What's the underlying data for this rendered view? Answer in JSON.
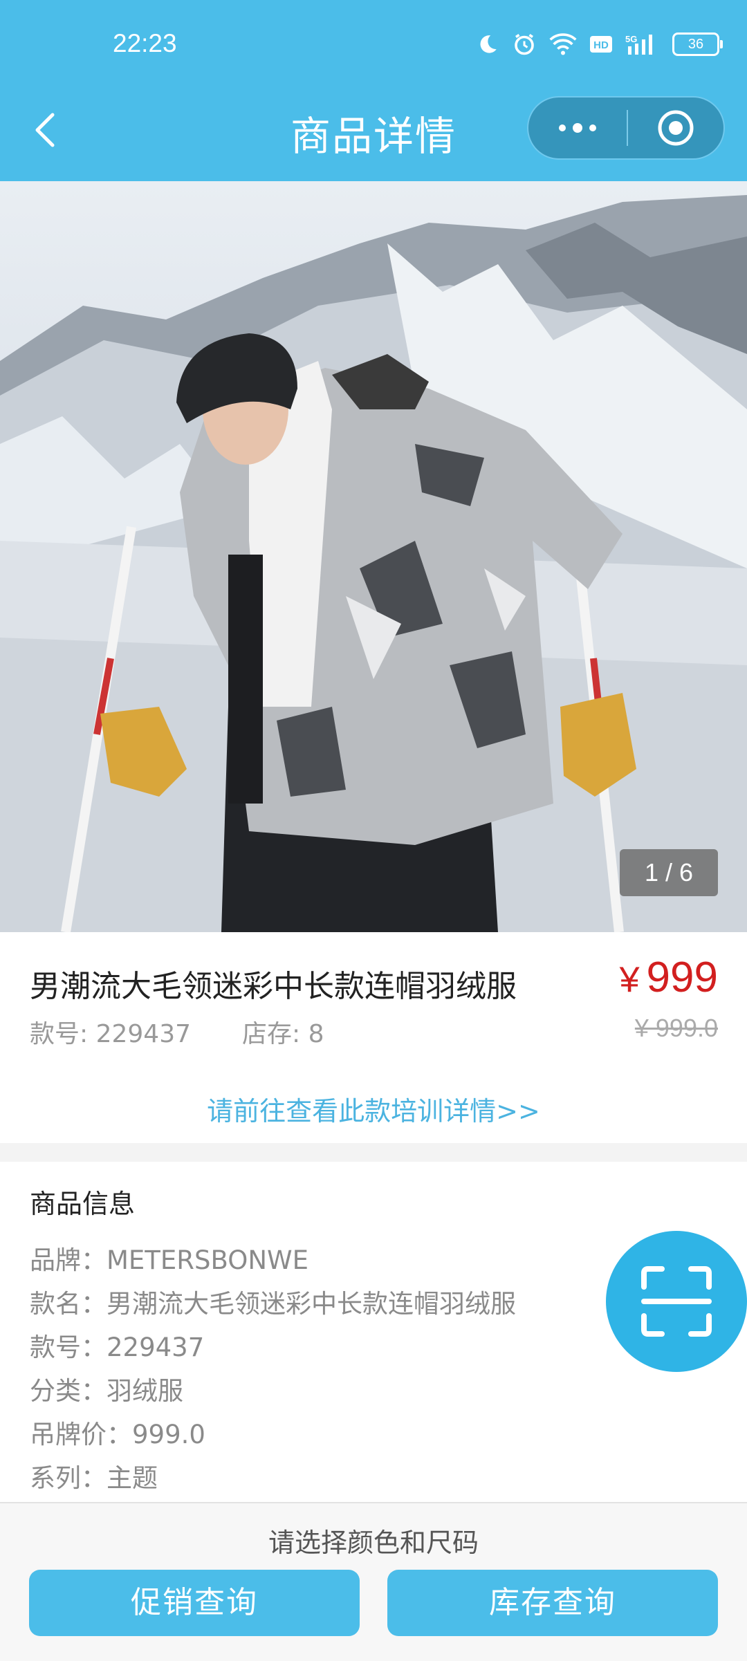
{
  "status_bar": {
    "time": "22:23",
    "battery": "36",
    "icons": [
      "moon-icon",
      "alarm-icon",
      "wifi-icon",
      "hd-icon",
      "5g-signal-icon",
      "battery-icon"
    ]
  },
  "header": {
    "title": "商品详情",
    "back_icon": "chevron-left-icon",
    "more_icon": "more-dots-icon",
    "record_icon": "record-icon"
  },
  "gallery": {
    "counter": "1 / 6",
    "current": 1,
    "total": 6
  },
  "product": {
    "name": "男潮流大毛领迷彩中长款连帽羽绒服",
    "currency": "¥",
    "price": "999",
    "style_no_text": "款号: 229437",
    "stock_text": "店存: 8",
    "original_price": "¥ 999.0",
    "training_link": "请前往查看此款培训详情>>"
  },
  "info": {
    "title": "商品信息",
    "attributes": [
      {
        "text": "品牌：METERSBONWE"
      },
      {
        "text": "款名：男潮流大毛领迷彩中长款连帽羽绒服"
      },
      {
        "text": "款号：229437"
      },
      {
        "text": "分类：羽绒服"
      },
      {
        "text": "吊牌价：999.0"
      },
      {
        "text": "系列：主题"
      }
    ]
  },
  "scan_button": {
    "icon": "scan-icon"
  },
  "footer": {
    "hint": "请选择颜色和尺码",
    "promo_button": "促销查询",
    "stock_button": "库存查询"
  },
  "colors": {
    "accent": "#4bbde9",
    "price": "#d21f1f",
    "link": "#4bb3e0"
  }
}
